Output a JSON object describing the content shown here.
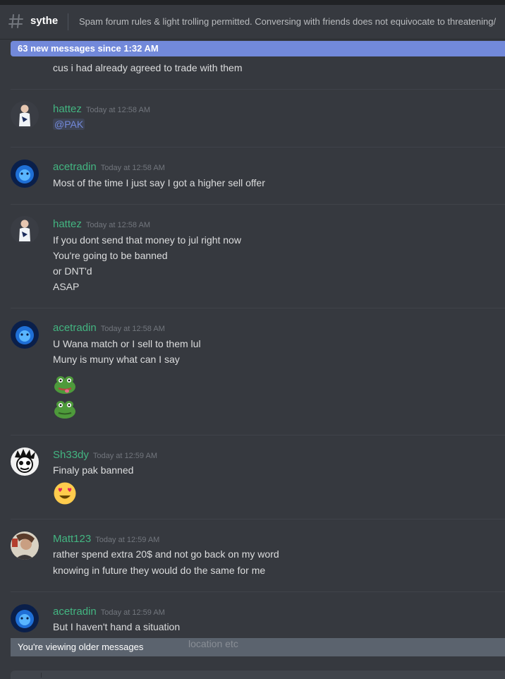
{
  "header": {
    "channel": "sythe",
    "topic": "Spam forum rules & light trolling permitted. Conversing with friends does not equivocate to threatening/"
  },
  "new_messages_bar": "63 new messages since 1:32 AM",
  "first_line": "cus i had already agreed to trade with them",
  "messages": [
    {
      "user": "hattez",
      "time": "Today at 12:58 AM",
      "lines": [
        "@PAK"
      ]
    },
    {
      "user": "acetradin",
      "time": "Today at 12:58 AM",
      "lines": [
        "Most of the time I just say I got a higher sell offer"
      ]
    },
    {
      "user": "hattez",
      "time": "Today at 12:58 AM",
      "lines": [
        "If you dont send that money to jul right now",
        "You're going to be banned",
        "or DNT'd",
        "ASAP"
      ]
    },
    {
      "user": "acetradin",
      "time": "Today at 12:58 AM",
      "lines": [
        "U Wana match or I sell to them lul",
        "Muny is muny what can I say"
      ]
    },
    {
      "user": "Sh33dy",
      "time": "Today at 12:59 AM",
      "lines": [
        "Finaly pak banned"
      ]
    },
    {
      "user": "Matt123",
      "time": "Today at 12:59 AM",
      "lines": [
        "rather spend extra 20$ and not go back on my word",
        "knowing in future they would do the same for me"
      ]
    },
    {
      "user": "acetradin",
      "time": "Today at 12:59 AM",
      "lines": [
        "But I haven't hand a situation"
      ]
    }
  ],
  "older_bar": "You're viewing older messages",
  "faded_text": "location etc",
  "colors": {
    "background": "#36393f",
    "username": "#43b581",
    "accent": "#7289da",
    "older_bar": "#5b636e"
  },
  "icons": [
    "hash-icon",
    "frog-emoji",
    "heart-eyes-emoji"
  ]
}
